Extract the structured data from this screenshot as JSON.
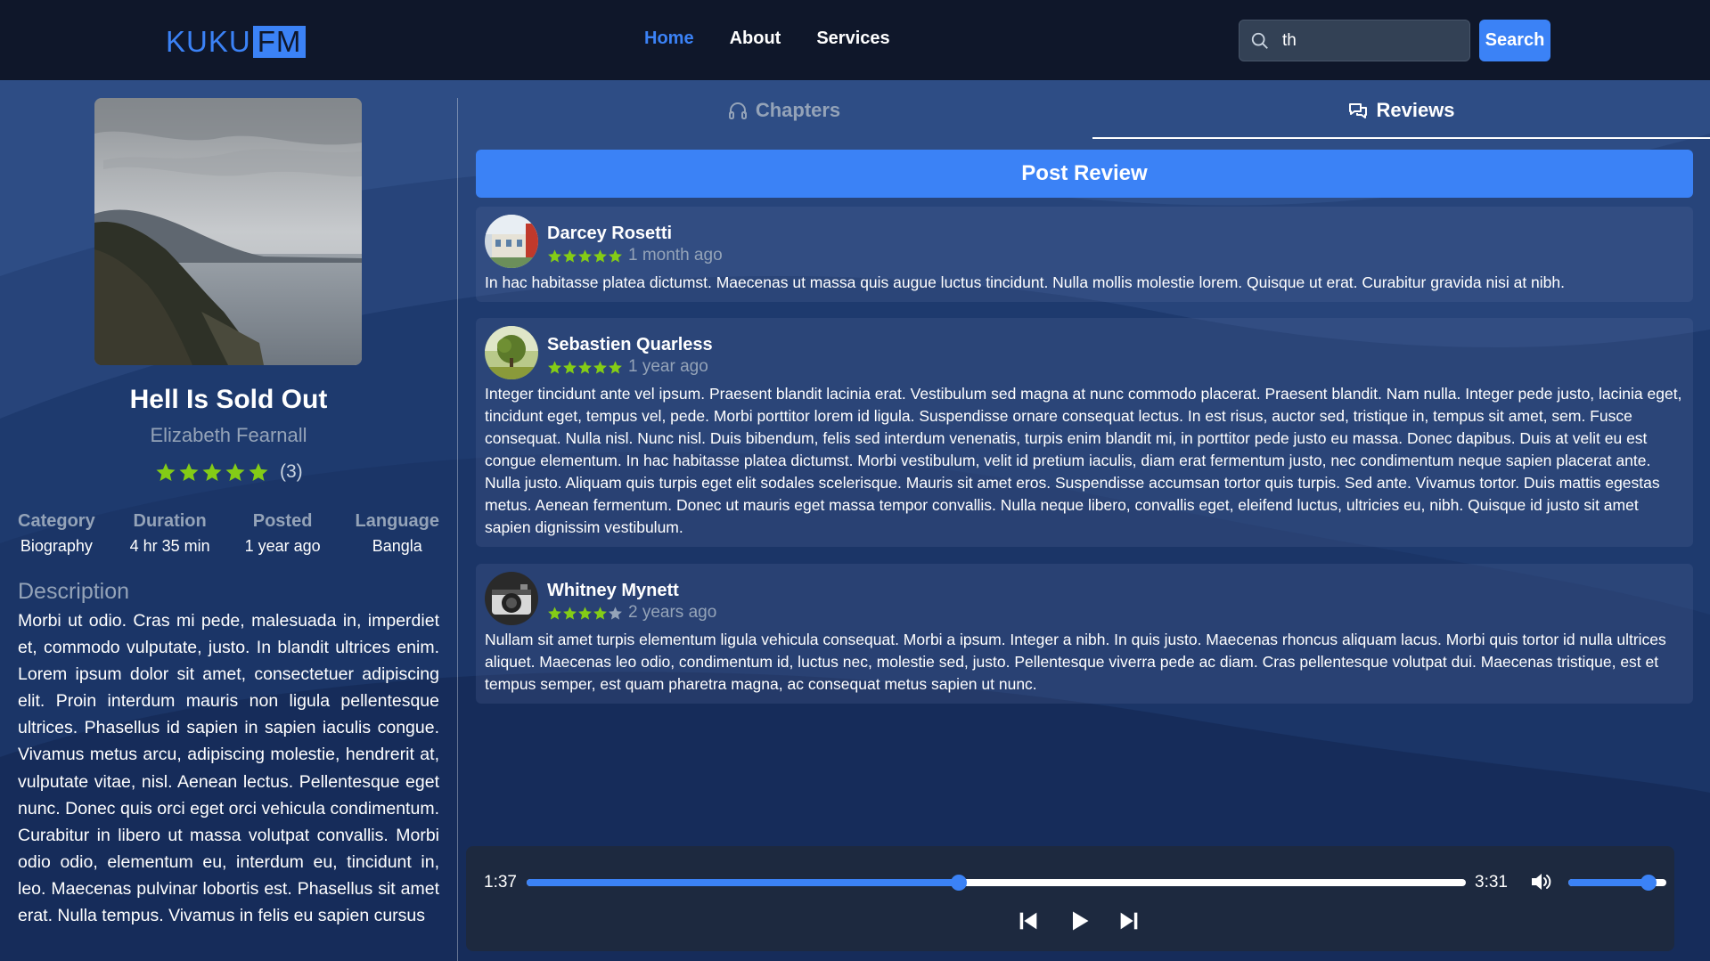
{
  "header": {
    "logo_kuku": "KUKU",
    "logo_fm": "FM",
    "nav": [
      {
        "label": "Home",
        "active": true
      },
      {
        "label": "About",
        "active": false
      },
      {
        "label": "Services",
        "active": false
      }
    ],
    "search_value": "th",
    "search_button": "Search"
  },
  "book": {
    "title": "Hell Is Sold Out",
    "author": "Elizabeth Fearnall",
    "rating_stars": 5,
    "rating_count": "(3)",
    "meta": [
      {
        "label": "Category",
        "value": "Biography"
      },
      {
        "label": "Duration",
        "value": "4 hr 35 min"
      },
      {
        "label": "Posted",
        "value": "1 year ago"
      },
      {
        "label": "Language",
        "value": "Bangla"
      }
    ],
    "description_title": "Description",
    "description": "Morbi ut odio. Cras mi pede, malesuada in, imperdiet et, commodo vulputate, justo. In blandit ultrices enim. Lorem ipsum dolor sit amet, consectetuer adipiscing elit. Proin interdum mauris non ligula pellentesque ultrices. Phasellus id sapien in sapien iaculis congue. Vivamus metus arcu, adipiscing molestie, hendrerit at, vulputate vitae, nisl. Aenean lectus. Pellentesque eget nunc. Donec quis orci eget orci vehicula condimentum. Curabitur in libero ut massa volutpat convallis. Morbi odio odio, elementum eu, interdum eu, tincidunt in, leo. Maecenas pulvinar lobortis est. Phasellus sit amet erat. Nulla tempus. Vivamus in felis eu sapien cursus"
  },
  "tabs": {
    "chapters": "Chapters",
    "reviews": "Reviews"
  },
  "post_review_label": "Post Review",
  "reviews": [
    {
      "name": "Darcey Rosetti",
      "stars": 5,
      "time": "1 month ago",
      "text": "In hac habitasse platea dictumst. Maecenas ut massa quis augue luctus tincidunt. Nulla mollis molestie lorem. Quisque ut erat. Curabitur gravida nisi at nibh."
    },
    {
      "name": "Sebastien Quarless",
      "stars": 5,
      "time": "1 year ago",
      "text": "Integer tincidunt ante vel ipsum. Praesent blandit lacinia erat. Vestibulum sed magna at nunc commodo placerat. Praesent blandit. Nam nulla. Integer pede justo, lacinia eget, tincidunt eget, tempus vel, pede. Morbi porttitor lorem id ligula. Suspendisse ornare consequat lectus. In est risus, auctor sed, tristique in, tempus sit amet, sem. Fusce consequat. Nulla nisl. Nunc nisl. Duis bibendum, felis sed interdum venenatis, turpis enim blandit mi, in porttitor pede justo eu massa. Donec dapibus. Duis at velit eu est congue elementum. In hac habitasse platea dictumst. Morbi vestibulum, velit id pretium iaculis, diam erat fermentum justo, nec condimentum neque sapien placerat ante. Nulla justo. Aliquam quis turpis eget elit sodales scelerisque. Mauris sit amet eros. Suspendisse accumsan tortor quis turpis. Sed ante. Vivamus tortor. Duis mattis egestas metus. Aenean fermentum. Donec ut mauris eget massa tempor convallis. Nulla neque libero, convallis eget, eleifend luctus, ultricies eu, nibh. Quisque id justo sit amet sapien dignissim vestibulum."
    },
    {
      "name": "Whitney Mynett",
      "stars": 4,
      "time": "2 years ago",
      "text": "Nullam sit amet turpis elementum ligula vehicula consequat. Morbi a ipsum. Integer a nibh. In quis justo. Maecenas rhoncus aliquam lacus. Morbi quis tortor id nulla ultrices aliquet. Maecenas leo odio, condimentum id, luctus nec, molestie sed, justo. Pellentesque viverra pede ac diam. Cras pellentesque volutpat dui. Maecenas tristique, est et tempus semper, est quam pharetra magna, ac consequat metus sapien ut nunc."
    }
  ],
  "player": {
    "current_time": "1:37",
    "total_time": "3:31",
    "progress": 0.46,
    "volume": 0.82
  },
  "colors": {
    "accent": "#3b82f6",
    "star": "#84cc16",
    "header_bg": "#0f172a"
  }
}
